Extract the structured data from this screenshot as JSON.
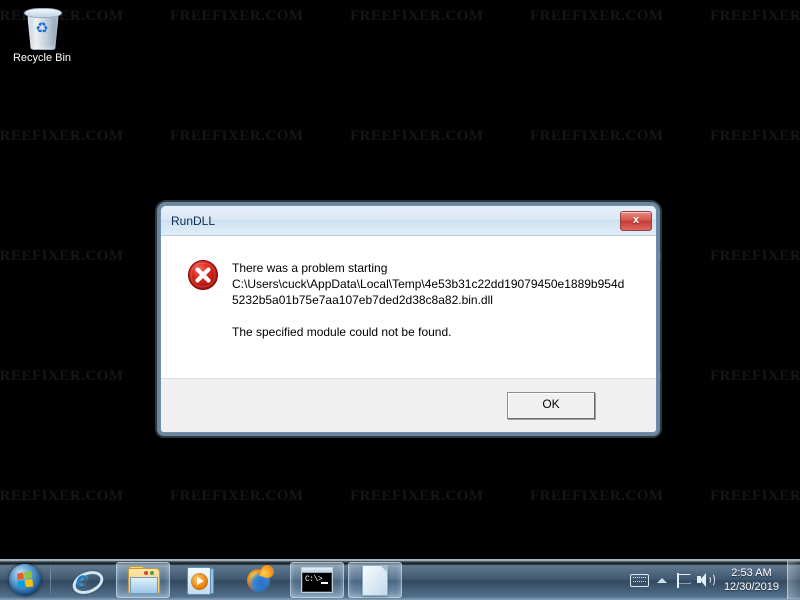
{
  "desktop": {
    "watermark_text": "FREEFIXER.COM",
    "icons": [
      {
        "name": "recycle-bin",
        "label": "Recycle Bin"
      }
    ]
  },
  "dialog": {
    "title": "RunDLL",
    "close_label": "x",
    "icon": "error-icon",
    "message_line_1": "There was a problem starting",
    "message_path": "C:\\Users\\cuck\\AppData\\Local\\Temp\\4e53b31c22dd19079450e1889b954d5232b5a01b75e7aa107eb7ded2d38c8a82.bin.dll",
    "message_line_2": "The specified module could not be found.",
    "ok_label": "OK"
  },
  "taskbar": {
    "start_label": "Start",
    "buttons": [
      {
        "name": "internet-explorer",
        "label": "Internet Explorer",
        "state": "pinned"
      },
      {
        "name": "windows-explorer",
        "label": "Windows Explorer",
        "state": "running"
      },
      {
        "name": "windows-media-player",
        "label": "Windows Media Player",
        "state": "pinned"
      },
      {
        "name": "firefox",
        "label": "Mozilla Firefox",
        "state": "pinned"
      },
      {
        "name": "command-prompt",
        "label": "Command Prompt",
        "state": "running"
      },
      {
        "name": "document-window",
        "label": "Document",
        "state": "running"
      }
    ],
    "tray": [
      {
        "name": "tablet-keyboard-icon",
        "label": "Tablet PC Input Panel"
      },
      {
        "name": "show-hidden-icons-icon",
        "label": "Show hidden icons"
      },
      {
        "name": "action-center-flag-icon",
        "label": "Action Center"
      },
      {
        "name": "volume-speaker-icon",
        "label": "Volume"
      }
    ],
    "clock": {
      "time": "2:53 AM",
      "date": "12/30/2019"
    },
    "show_desktop_label": "Show desktop"
  },
  "colors": {
    "desktop_bg": "#010101",
    "dialog_bg": "#f0f0f0",
    "dialog_content_bg": "#ffffff",
    "titlebar": "#dbe9f5",
    "close_red": "#c23c36",
    "error_red": "#cc0000",
    "taskbar_blue": "#3d566f",
    "accent_blue": "#1f7fc4"
  }
}
